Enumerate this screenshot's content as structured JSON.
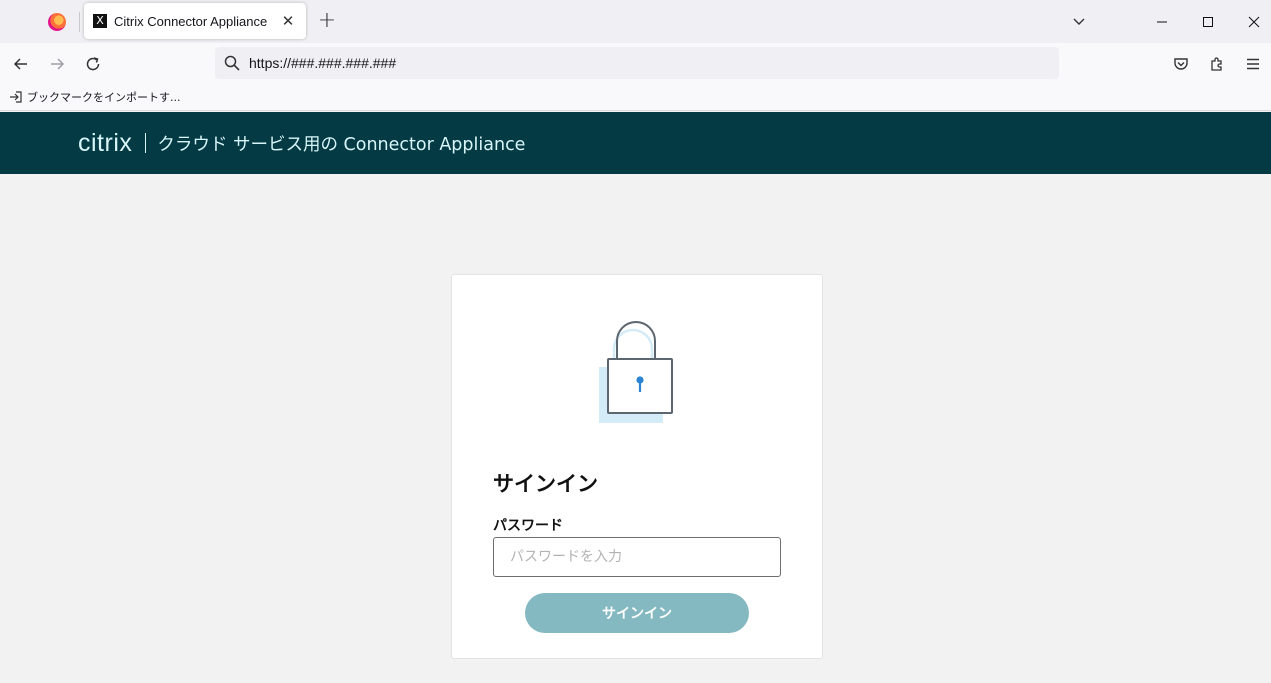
{
  "browser": {
    "tab": {
      "title": "Citrix Connector Appliance",
      "close_glyph": "✕",
      "favicon_glyph": "X"
    },
    "new_tab_glyph": "+",
    "url": "https://###.###.###.###",
    "bookmarks": [
      {
        "label": "ブックマークをインポートす..."
      }
    ],
    "icons": [
      "firefox-logo",
      "tab-list-chevron",
      "minimize",
      "maximize",
      "close",
      "back-arrow",
      "forward-arrow",
      "reload",
      "search",
      "pocket",
      "extensions",
      "menu",
      "import"
    ]
  },
  "header": {
    "logo": "citrix",
    "title": "クラウド サービス用の Connector Appliance",
    "bg_color": "#033a44"
  },
  "signin": {
    "title": "サインイン",
    "password_label": "パスワード",
    "password_placeholder": "パスワードを入力",
    "button_label": "サインイン",
    "button_color": "#84b9c2"
  }
}
